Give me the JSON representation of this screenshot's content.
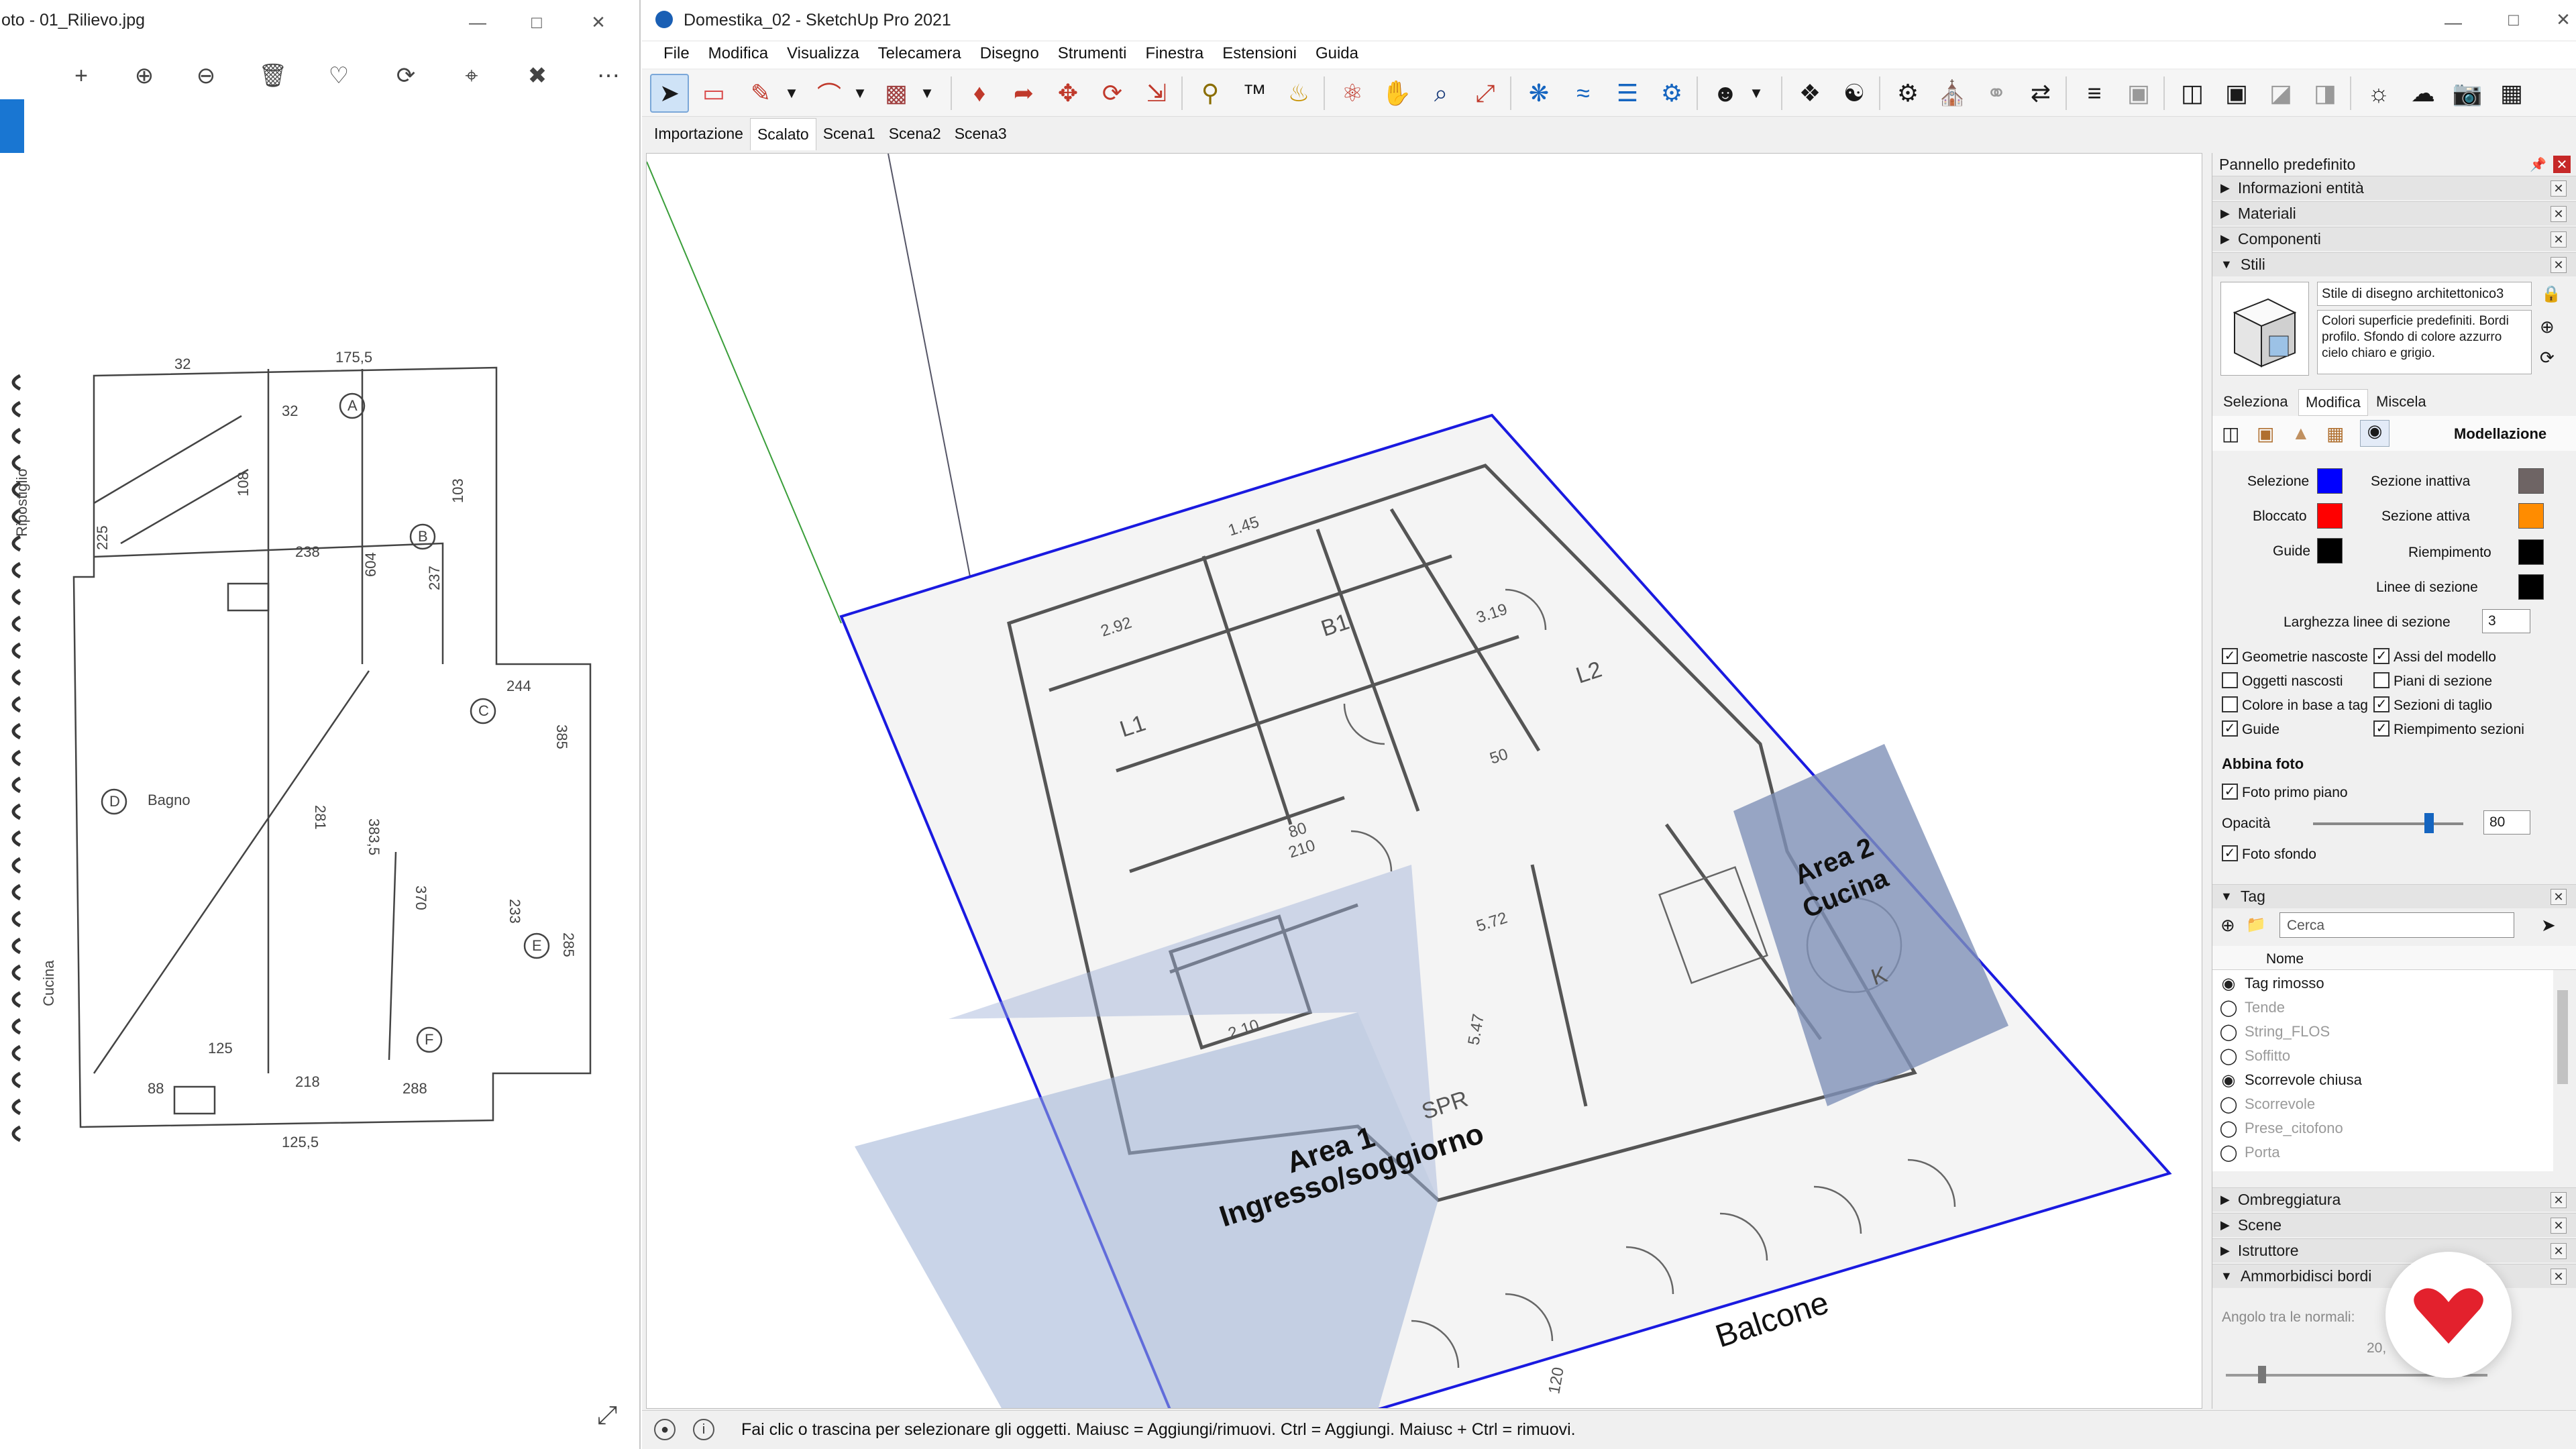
{
  "photo_viewer": {
    "title": "oto - 01_Rilievo.jpg",
    "sketch_numbers": [
      "175,5",
      "32",
      "32",
      "108",
      "225",
      "103",
      "238",
      "604",
      "237",
      "244",
      "385",
      "383,5",
      "281",
      "370",
      "233",
      "285",
      "125",
      "88",
      "288",
      "218",
      "125,5"
    ],
    "sketch_words": [
      "Ripostiglio",
      "Bagno",
      "Cucina"
    ],
    "sketch_circles": [
      "A",
      "B",
      "C",
      "D",
      "E",
      "F"
    ]
  },
  "sketchup": {
    "title": "Domestika_02 - SketchUp Pro 2021",
    "menu": [
      "File",
      "Modifica",
      "Visualizza",
      "Telecamera",
      "Disegno",
      "Strumenti",
      "Finestra",
      "Estensioni",
      "Guida"
    ],
    "tabs": [
      {
        "label": "Importazione",
        "active": false
      },
      {
        "label": "Scalato",
        "active": true
      },
      {
        "label": "Scena1",
        "active": false
      },
      {
        "label": "Scena2",
        "active": false
      },
      {
        "label": "Scena3",
        "active": false
      }
    ],
    "plan": {
      "area1_title": "Area 1",
      "area1_sub": "Ingresso/soggiorno",
      "area2_title": "Area 2",
      "area2_sub": "Cucina",
      "balcone": "Balcone",
      "labels": [
        "L1",
        "B1",
        "L2",
        "SPR",
        "K",
        "1.45",
        "3.19",
        "2.92",
        "2.10",
        "5.47",
        "5.72",
        "50",
        "80",
        "210",
        "120"
      ]
    },
    "status": "Fai clic o trascina per selezionare gli oggetti. Maiusc = Aggiungi/rimuovi. Ctrl = Aggiungi. Maiusc + Ctrl = rimuovi."
  },
  "tray": {
    "title": "Pannello predefinito",
    "panels_top": [
      "Informazioni entità",
      "Materiali",
      "Componenti",
      "Stili"
    ],
    "style_name": "Stile di disegno architettonico3",
    "style_desc": "Colori superficie predefiniti. Bordi profilo. Sfondo di colore azzurro cielo chiaro e grigio.",
    "subtabs": [
      "Seleziona",
      "Modifica",
      "Miscela"
    ],
    "section_title": "Modellazione",
    "colors": {
      "selezione": {
        "label": "Selezione",
        "hex": "#0000ff"
      },
      "bloccato": {
        "label": "Bloccato",
        "hex": "#ff0000"
      },
      "guide": {
        "label": "Guide",
        "hex": "#000000"
      },
      "sezione_inattiva": {
        "label": "Sezione inattiva",
        "hex": "#6e6464"
      },
      "sezione_attiva": {
        "label": "Sezione attiva",
        "hex": "#ff8c00"
      },
      "riempimento": {
        "label": "Riempimento",
        "hex": "#000000"
      },
      "linee_sezione": {
        "label": "Linee di sezione",
        "hex": "#000000"
      }
    },
    "line_width_label": "Larghezza linee di sezione",
    "line_width": "3",
    "checks": [
      {
        "label": "Geometrie nascoste",
        "checked": true
      },
      {
        "label": "Assi del modello",
        "checked": true
      },
      {
        "label": "Oggetti nascosti",
        "checked": false
      },
      {
        "label": "Piani di sezione",
        "checked": false
      },
      {
        "label": "Colore in base a tag",
        "checked": false
      },
      {
        "label": "Sezioni di taglio",
        "checked": true
      },
      {
        "label": "Guide",
        "checked": true
      },
      {
        "label": "Riempimento sezioni",
        "checked": true
      }
    ],
    "photo_match_title": "Abbina foto",
    "foto_primo_piano": "Foto primo piano",
    "opacita_label": "Opacità",
    "opacita": "80",
    "foto_sfondo": "Foto sfondo",
    "tag_title": "Tag",
    "search_placeholder": "Cerca",
    "tag_column": "Nome",
    "tags": [
      {
        "name": "Tag rimosso",
        "visible": true
      },
      {
        "name": "Tende",
        "visible": false
      },
      {
        "name": "String_FLOS",
        "visible": false
      },
      {
        "name": "Soffitto",
        "visible": false
      },
      {
        "name": "Scorrevole chiusa",
        "visible": true
      },
      {
        "name": "Scorrevole",
        "visible": false
      },
      {
        "name": "Prese_citofono",
        "visible": false
      },
      {
        "name": "Porta",
        "visible": false
      }
    ],
    "panels_bottom": [
      "Ombreggiatura",
      "Scene",
      "Istruttore",
      "Ammorbidisci bordi"
    ],
    "smooth_label": "Angolo tra le normali:",
    "smooth_value": "20,"
  }
}
